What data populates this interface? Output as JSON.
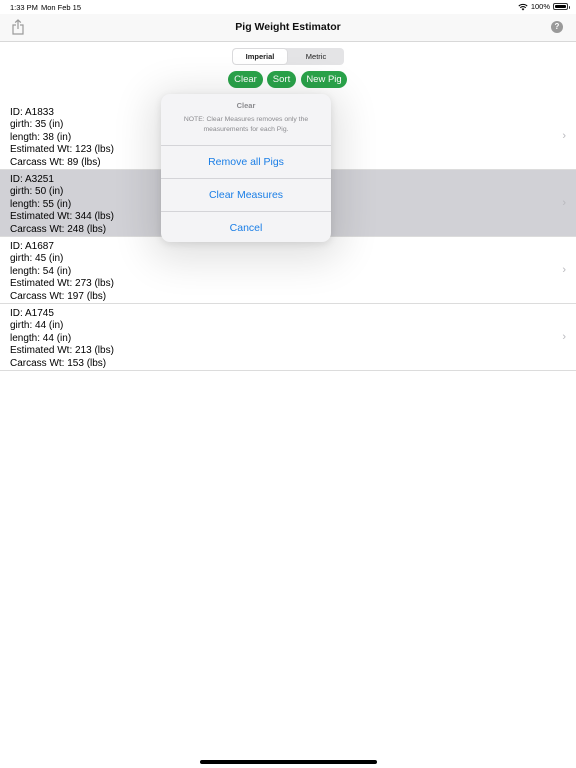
{
  "status_bar": {
    "time": "1:33 PM",
    "date": "Mon Feb 15",
    "battery": "100%",
    "wifi_icon": "wifi-icon",
    "battery_icon": "battery-icon"
  },
  "nav": {
    "title": "Pig Weight Estimator",
    "share_icon": "share-icon",
    "help_label": "?"
  },
  "units": {
    "options": [
      "Imperial",
      "Metric"
    ],
    "selected": "Imperial"
  },
  "actions": {
    "clear": "Clear",
    "sort": "Sort",
    "new_pig": "New Pig",
    "color": "#2aa34a"
  },
  "pigs": [
    {
      "id": "ID: A1833",
      "girth": "girth: 35 (in)",
      "length": "length: 38 (in)",
      "est": "Estimated Wt: 123 (lbs)",
      "carcass": "Carcass Wt: 89 (lbs)"
    },
    {
      "id": "ID: A3251",
      "girth": "girth: 50 (in)",
      "length": "length: 55 (in)",
      "est": "Estimated Wt: 344 (lbs)",
      "carcass": "Carcass Wt: 248 (lbs)"
    },
    {
      "id": "ID: A1687",
      "girth": "girth: 45 (in)",
      "length": "length: 54 (in)",
      "est": "Estimated Wt: 273 (lbs)",
      "carcass": "Carcass Wt: 197 (lbs)"
    },
    {
      "id": "ID: A1745",
      "girth": "girth: 44 (in)",
      "length": "length: 44 (in)",
      "est": "Estimated Wt: 213 (lbs)",
      "carcass": "Carcass Wt: 153 (lbs)"
    }
  ],
  "popover": {
    "title": "Clear",
    "message": "NOTE: Clear Measures removes only the measurements for each Pig.",
    "remove_all": "Remove all Pigs",
    "clear_measures": "Clear Measures",
    "cancel": "Cancel",
    "action_color": "#1a7ee6"
  }
}
